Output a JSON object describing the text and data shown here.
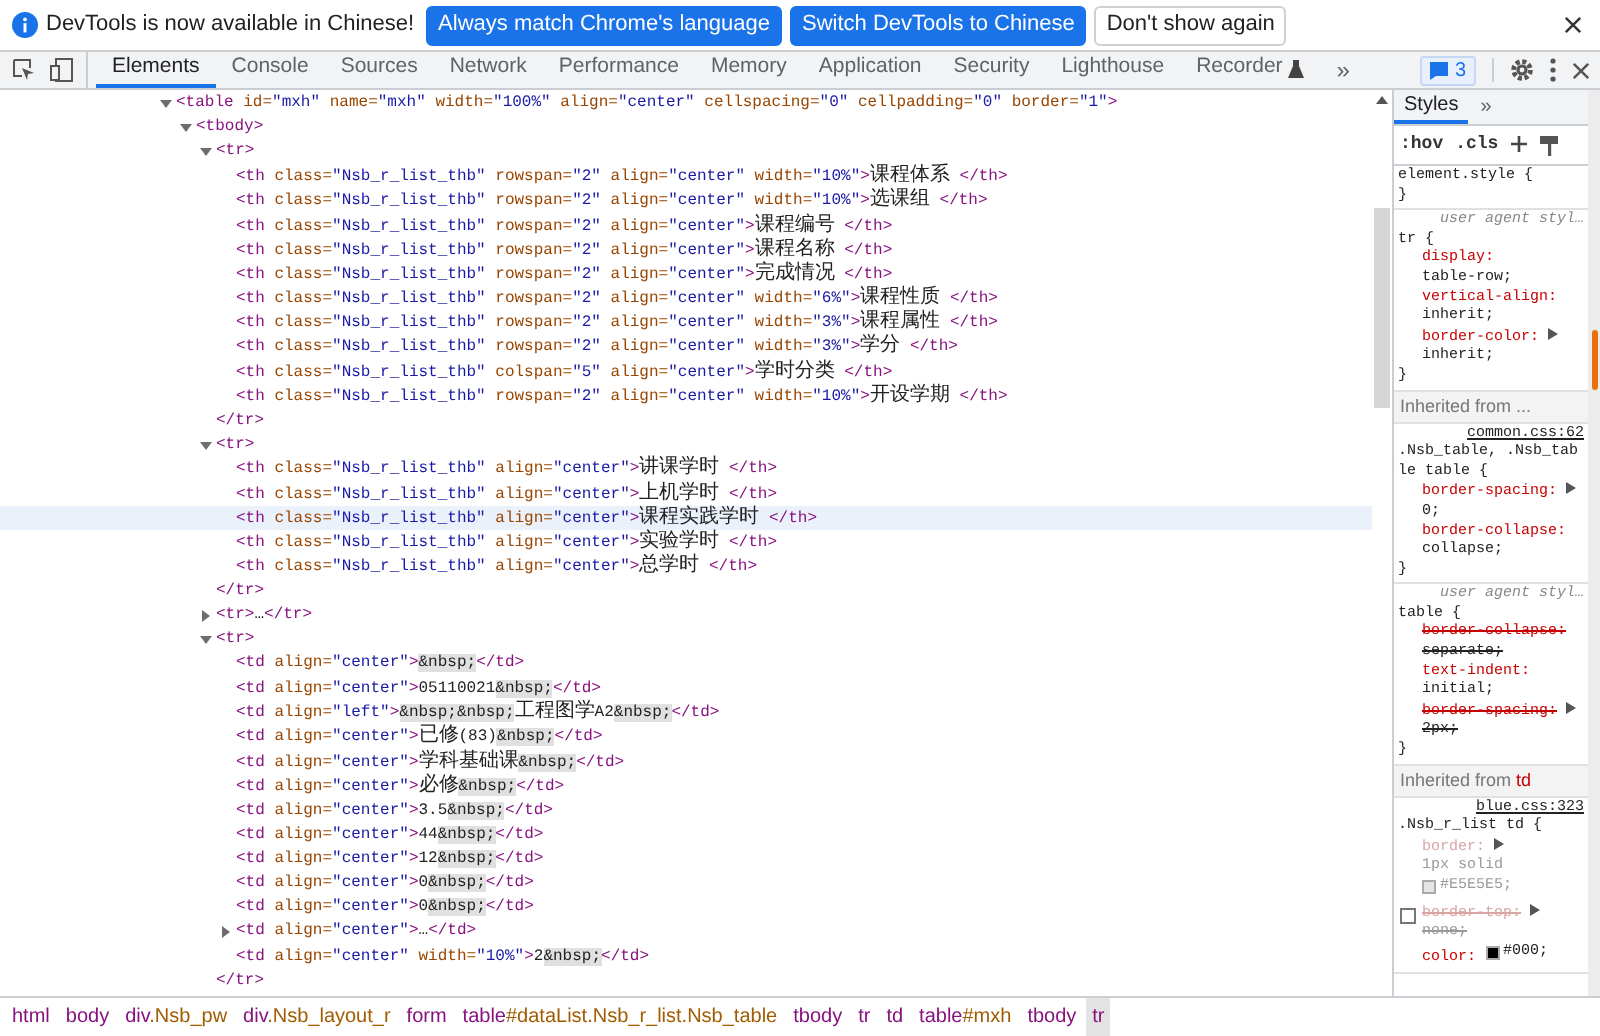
{
  "infobar": {
    "message": "DevTools is now available in Chinese!",
    "buttons": [
      {
        "label": "Always match Chrome's language",
        "kind": "primary"
      },
      {
        "label": "Switch DevTools to Chinese",
        "kind": "primary"
      },
      {
        "label": "Don't show again",
        "kind": "secondary"
      }
    ]
  },
  "tabs": [
    {
      "label": "Elements",
      "selected": true,
      "experimental": false
    },
    {
      "label": "Console",
      "selected": false,
      "experimental": false
    },
    {
      "label": "Sources",
      "selected": false,
      "experimental": false
    },
    {
      "label": "Network",
      "selected": false,
      "experimental": false
    },
    {
      "label": "Performance",
      "selected": false,
      "experimental": false
    },
    {
      "label": "Memory",
      "selected": false,
      "experimental": false
    },
    {
      "label": "Application",
      "selected": false,
      "experimental": false
    },
    {
      "label": "Security",
      "selected": false,
      "experimental": false
    },
    {
      "label": "Lighthouse",
      "selected": false,
      "experimental": false
    },
    {
      "label": "Recorder",
      "selected": false,
      "experimental": true
    }
  ],
  "more_tabs": "»",
  "issues_count": "3",
  "dom_tree": {
    "text": "<table id=\"mxh\" name=\"mxh\" width=\"100%\" align=\"center\" cellspacing=\"0\" cellpadding=\"0\" border=\"1\">",
    "expanded": true,
    "selected": false,
    "children": [
      {
        "text": "<tbody>",
        "expanded": true,
        "selected": false,
        "children": [
          {
            "text": "<tr>",
            "expanded": true,
            "selected": false,
            "close": "</tr>",
            "children": [
              {
                "text": "<th class=\"Nsb_r_list_thb\" rowspan=\"2\" align=\"center\" width=\"10%\">课程体系 </th>",
                "selected": false
              },
              {
                "text": "<th class=\"Nsb_r_list_thb\" rowspan=\"2\" align=\"center\" width=\"10%\">选课组 </th>",
                "selected": false
              },
              {
                "text": "<th class=\"Nsb_r_list_thb\" rowspan=\"2\" align=\"center\">课程编号 </th>",
                "selected": false
              },
              {
                "text": "<th class=\"Nsb_r_list_thb\" rowspan=\"2\" align=\"center\">课程名称 </th>",
                "selected": false
              },
              {
                "text": "<th class=\"Nsb_r_list_thb\" rowspan=\"2\" align=\"center\">完成情况 </th>",
                "selected": false
              },
              {
                "text": "<th class=\"Nsb_r_list_thb\" rowspan=\"2\" align=\"center\" width=\"6%\">课程性质 </th>",
                "selected": false
              },
              {
                "text": "<th class=\"Nsb_r_list_thb\" rowspan=\"2\" align=\"center\" width=\"3%\">课程属性 </th>",
                "selected": false
              },
              {
                "text": "<th class=\"Nsb_r_list_thb\" rowspan=\"2\" align=\"center\" width=\"3%\">学分 </th>",
                "selected": false
              },
              {
                "text": "<th class=\"Nsb_r_list_thb\" colspan=\"5\" align=\"center\">学时分类 </th>",
                "selected": false
              },
              {
                "text": "<th class=\"Nsb_r_list_thb\" rowspan=\"2\" align=\"center\" width=\"10%\">开设学期 </th>",
                "selected": false
              }
            ]
          },
          {
            "text": "<tr>",
            "expanded": true,
            "selected": false,
            "close": "</tr>",
            "children": [
              {
                "text": "<th class=\"Nsb_r_list_thb\" align=\"center\">讲课学时 </th>",
                "selected": false
              },
              {
                "text": "<th class=\"Nsb_r_list_thb\" align=\"center\">上机学时 </th>",
                "selected": false
              },
              {
                "text": "<th class=\"Nsb_r_list_thb\" align=\"center\">课程实践学时 </th>",
                "selected": true
              },
              {
                "text": "<th class=\"Nsb_r_list_thb\" align=\"center\">实验学时 </th>",
                "selected": false
              },
              {
                "text": "<th class=\"Nsb_r_list_thb\" align=\"center\">总学时 </th>",
                "selected": false
              }
            ]
          },
          {
            "text": "<tr>…</tr>",
            "expanded": false,
            "selected": false
          },
          {
            "text": "<tr>",
            "expanded": true,
            "selected": false,
            "close": "</tr>",
            "children": [
              {
                "text": "<td align=\"center\">&nbsp;</td>",
                "selected": false
              },
              {
                "text": "<td align=\"center\">05110021&nbsp;</td>",
                "selected": false
              },
              {
                "text": "<td align=\"left\">&nbsp;&nbsp;工程图学A2&nbsp;</td>",
                "selected": false
              },
              {
                "text": "<td align=\"center\">已修(83)&nbsp;</td>",
                "selected": false
              },
              {
                "text": "<td align=\"center\">学科基础课&nbsp;</td>",
                "selected": false
              },
              {
                "text": "<td align=\"center\">必修&nbsp;</td>",
                "selected": false
              },
              {
                "text": "<td align=\"center\">3.5&nbsp;</td>",
                "selected": false
              },
              {
                "text": "<td align=\"center\">44&nbsp;</td>",
                "selected": false
              },
              {
                "text": "<td align=\"center\">12&nbsp;</td>",
                "selected": false
              },
              {
                "text": "<td align=\"center\">0&nbsp;</td>",
                "selected": false
              },
              {
                "text": "<td align=\"center\">0&nbsp;</td>",
                "selected": false
              },
              {
                "text": "<td align=\"center\">…</td>",
                "expanded": false,
                "selected": false
              },
              {
                "text": "<td align=\"center\" width=\"10%\">2&nbsp;</td>",
                "selected": false
              }
            ]
          }
        ]
      }
    ]
  },
  "styles_pane": {
    "tabs": [
      {
        "label": "Styles",
        "selected": true
      }
    ],
    "more_tabs": "»",
    "filter_buttons": [
      ":hov",
      ".cls"
    ],
    "rules": [
      {
        "kind": "rule",
        "selector": "element.style {",
        "end": "}"
      },
      {
        "kind": "rule",
        "origin": "user agent styl…",
        "selector": "tr {",
        "end": "}",
        "properties": [
          {
            "name": "display:",
            "value": "table-row;",
            "expandable": false,
            "struck": false,
            "dimmed": false
          },
          {
            "name": "vertical-align:",
            "value": "inherit;",
            "expandable": false,
            "struck": false,
            "dimmed": false
          },
          {
            "name": "border-color:",
            "value": "inherit;",
            "expandable": true,
            "struck": false,
            "dimmed": false
          }
        ]
      },
      {
        "kind": "inherited",
        "label": "Inherited from ..."
      },
      {
        "kind": "rule",
        "source": "common.css:62",
        "selector": ".Nsb_table, .Nsb_table table {",
        "end": "}",
        "properties": [
          {
            "name": "border-spacing:",
            "value": "0;",
            "expandable": true,
            "struck": false,
            "dimmed": false
          },
          {
            "name": "border-collapse:",
            "value": "collapse;",
            "expandable": false,
            "struck": false,
            "dimmed": false
          }
        ]
      },
      {
        "kind": "rule",
        "origin": "user agent styl…",
        "selector": "table {",
        "end": "}",
        "properties": [
          {
            "name": "border-collapse:",
            "value": "separate;",
            "expandable": false,
            "struck": true,
            "dimmed": false
          },
          {
            "name": "text-indent:",
            "value": "initial;",
            "expandable": false,
            "struck": false,
            "dimmed": false
          },
          {
            "name": "border-spacing:",
            "value": "2px;",
            "expandable": true,
            "struck": true,
            "dimmed": false
          }
        ]
      },
      {
        "kind": "inherited",
        "label": "Inherited from",
        "element": "td"
      },
      {
        "kind": "rule",
        "source": "blue.css:323",
        "selector": ".Nsb_r_list td {",
        "properties": [
          {
            "name": "border:",
            "value": "1px solid",
            "swatch_value": "#E5E5E5;",
            "expandable": true,
            "struck": false,
            "dimmed": true
          },
          {
            "name": "border-top:",
            "value": "none;",
            "expandable": true,
            "struck": true,
            "dimmed": true,
            "checked": false
          },
          {
            "name": "color:",
            "swatch_value": "#000;",
            "expandable": false,
            "struck": false,
            "dimmed": false
          }
        ]
      }
    ]
  },
  "breadcrumbs": [
    {
      "label": "html",
      "selected": false
    },
    {
      "label": "body",
      "selected": false
    },
    {
      "label": "div.Nsb_pw",
      "selected": false
    },
    {
      "label": "div.Nsb_layout_r",
      "selected": false
    },
    {
      "label": "form",
      "selected": false
    },
    {
      "label": "table#dataList.Nsb_r_list.Nsb_table",
      "selected": false
    },
    {
      "label": "tbody",
      "selected": false
    },
    {
      "label": "tr",
      "selected": false
    },
    {
      "label": "td",
      "selected": false
    },
    {
      "label": "table#mxh",
      "selected": false
    },
    {
      "label": "tbody",
      "selected": false
    },
    {
      "label": "tr",
      "selected": true
    }
  ]
}
